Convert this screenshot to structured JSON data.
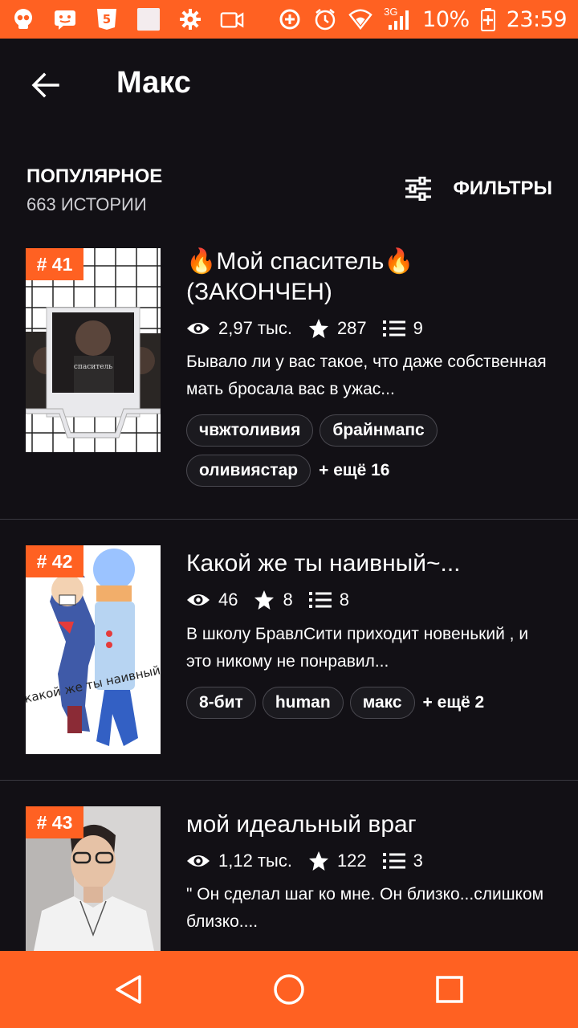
{
  "status_bar": {
    "battery": "10%",
    "time": "23:59",
    "network": "3G",
    "icons": [
      "skull-icon",
      "chat-icon",
      "html5-icon",
      "blank-app-icon",
      "gear-icon",
      "video-icon",
      "data-saver-icon",
      "alarm-icon",
      "wifi-icon",
      "signal-icon",
      "battery-icon"
    ]
  },
  "app_bar": {
    "title": "Макс",
    "back_icon": "arrow-left-icon"
  },
  "section": {
    "title": "ПОПУЛЯРНОЕ",
    "count": "663 ИСТОРИИ",
    "filter_label": "ФИЛЬТРЫ",
    "filter_icon": "sliders-icon"
  },
  "stories": [
    {
      "rank": "# 41",
      "title": "🔥Мой спаситель🔥 (ЗАКОНЧЕН)",
      "views": "2,97 тыс.",
      "votes": "287",
      "parts": "9",
      "description": "Бывало ли у вас такое, что даже собственная мать бросала вас в ужас...",
      "tags": [
        "чвжтоливия",
        "брайнмапс",
        "оливиястар"
      ],
      "more": "+ ещё 16"
    },
    {
      "rank": "# 42",
      "title": "Какой же ты наивный~...",
      "views": "46",
      "votes": "8",
      "parts": "8",
      "description": "В школу БравлСити приходит новенький , и это никому не понравил...",
      "tags": [
        "8-бит",
        "human",
        "макс"
      ],
      "more": "+ ещё 2"
    },
    {
      "rank": "# 43",
      "title": "мой идеальный враг",
      "views": "1,12 тыс.",
      "votes": "122",
      "parts": "3",
      "description": "\" Он сделал шаг ко мне. Он близко...слишком близко....",
      "tags": [],
      "more": ""
    }
  ],
  "nav_bar": {
    "icons": [
      "back-triangle-icon",
      "home-circle-icon",
      "recents-square-icon"
    ]
  },
  "colors": {
    "accent": "#ff6122",
    "background": "#121015",
    "divider": "#3a3940"
  }
}
